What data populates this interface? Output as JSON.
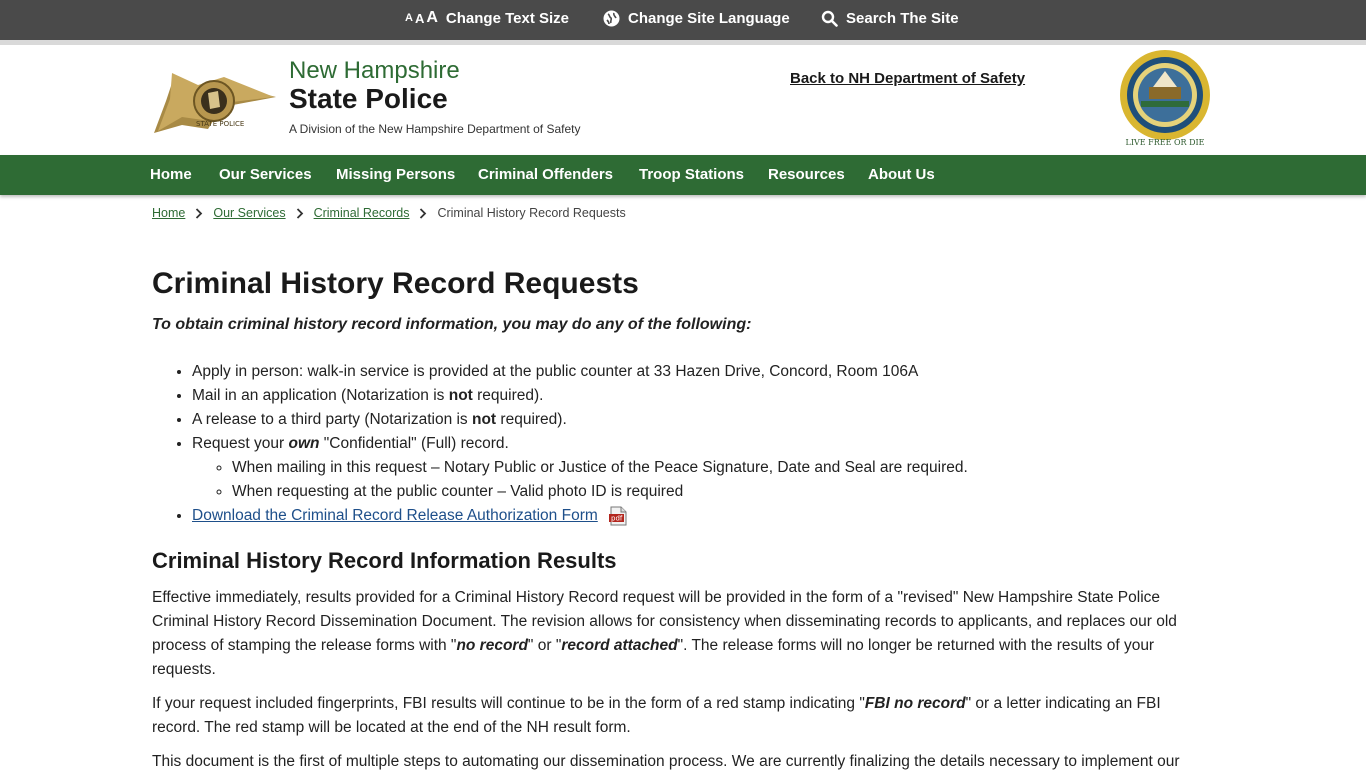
{
  "utility": {
    "text_size_glyphs": [
      "A",
      "A",
      "A"
    ],
    "text_size_label": "Change Text Size",
    "language_label": "Change Site Language",
    "search_label": "Search The Site"
  },
  "header": {
    "brand_top": "New Hampshire",
    "brand_main": "State Police",
    "brand_sub": "A Division of the New Hampshire Department of Safety",
    "back_link": "Back to NH Department of Safety",
    "badge_text": "STATE POLICE",
    "seal_text": "LIVE FREE OR DIE"
  },
  "nav": {
    "items": [
      "Home",
      "Our Services",
      "Missing Persons",
      "Criminal Offenders",
      "Troop Stations",
      "Resources",
      "About Us"
    ]
  },
  "breadcrumb": {
    "links": [
      "Home",
      "Our Services",
      "Criminal Records"
    ],
    "current": "Criminal History Record Requests"
  },
  "main": {
    "title": "Criminal History Record Requests",
    "intro": "To obtain criminal history record information, you may do any of the following:",
    "bullets": {
      "b1": "Apply in person: walk-in service is provided at the public counter at 33 Hazen Drive, Concord, Room 106A",
      "b2_pre": "Mail in an application (Notarization is ",
      "b2_bold": "not",
      "b2_post": " required).",
      "b3_pre": "A release to a third party (Notarization is ",
      "b3_bold": "not",
      "b3_post": " required).",
      "b4_pre": "Request your ",
      "b4_em": "own",
      "b4_post": " \"Confidential\" (Full) record.",
      "sub1": "When mailing in this request – Notary Public or Justice of the Peace Signature, Date and Seal are required.",
      "sub2": "When requesting at the public counter – Valid photo ID is required",
      "download": "Download the Criminal Record Release Authorization Form",
      "pdf_label": "pdf"
    },
    "results_heading": "Criminal History Record Information Results",
    "p1_a": "Effective immediately, results provided for a Criminal History Record request will be provided in the form of a \"revised\" New Hampshire State Police Criminal History Record Dissemination Document. The revision allows for consistency when disseminating records to applicants, and replaces our old process of stamping the release forms with \"",
    "p1_em1": "no record",
    "p1_b": "\" or \"",
    "p1_em2": "record attached",
    "p1_c": "\". The release forms will no longer be returned with the results of your requests.",
    "p2_a": "If your request included fingerprints, FBI results will continue to be in the form of a red stamp indicating \"",
    "p2_em": "FBI no record",
    "p2_b": "\" or a letter indicating an FBI record. The red stamp will be located at the end of the NH result form.",
    "p3": "This document is the first of multiple steps to automating our dissemination process. We are currently finalizing the details necessary to implement our"
  },
  "colors": {
    "utility_bar": "#4a4a4a",
    "brand_green": "#2e6b34",
    "link_blue": "#1e4f8a",
    "pdf_red": "#b3261e"
  }
}
